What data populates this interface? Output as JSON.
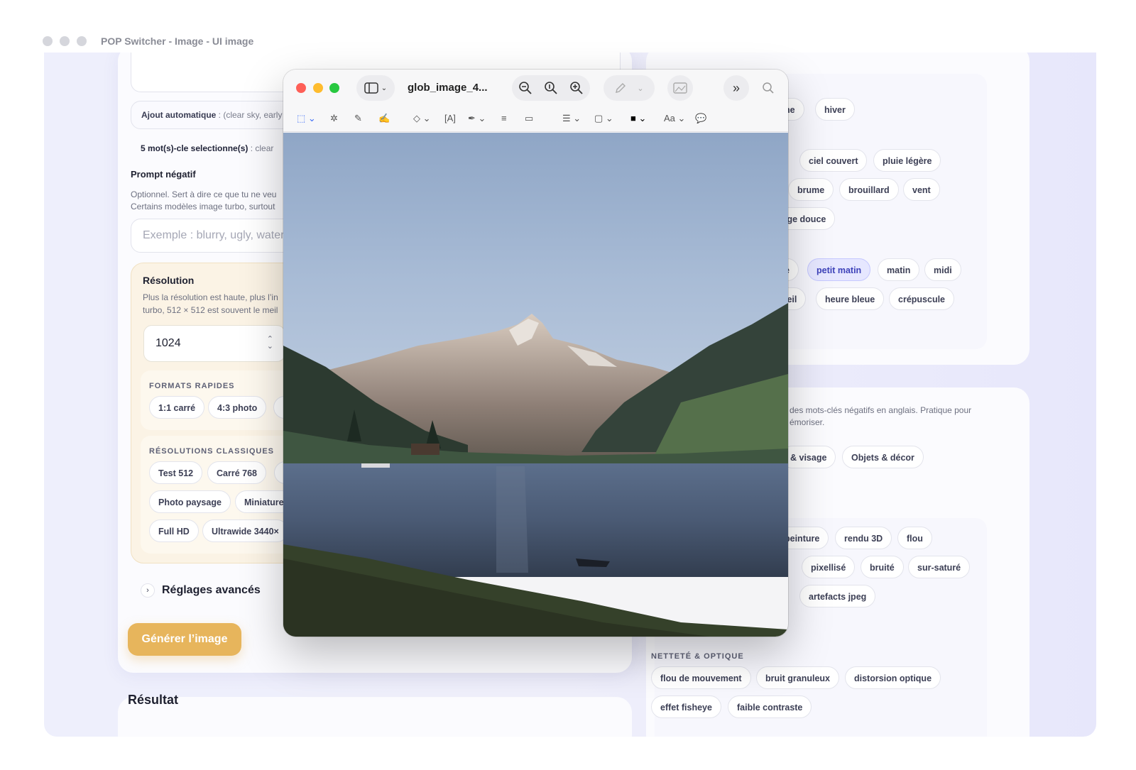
{
  "window": {
    "title": "POP Switcher - Image - UI image"
  },
  "left": {
    "auto_add_label": "Ajout automatique",
    "auto_add_text": " : (clear sky, early",
    "selected_label": "5 mot(s)-cle selectionne(s)",
    "selected_text": " : clear",
    "negative_title": "Prompt négatif",
    "negative_desc_1": "Optionnel. Sert à dire ce que tu ne veu",
    "negative_desc_2": "Certains modèles image turbo, surtout",
    "negative_placeholder": "Exemple : blurry, ugly, water",
    "resolution_title": "Résolution",
    "resolution_desc_1": "Plus la résolution est haute, plus l’in",
    "resolution_desc_2": "turbo, 512 × 512 est souvent le meil",
    "resolution_value": "1024",
    "quick_formats_label": "FORMATS RAPIDES",
    "quick_formats": [
      "1:1 carré",
      "4:3 photo"
    ],
    "classic_label": "RÉSOLUTIONS CLASSIQUES",
    "classic_row1": [
      "Test 512",
      "Carré 768"
    ],
    "classic_row2": [
      "Photo paysage",
      "Miniature"
    ],
    "classic_row3": [
      "Full HD",
      "Ultrawide 3440×"
    ],
    "advanced_label": "Réglages avancés",
    "generate_label": "Générer l’image",
    "result_title": "Résultat"
  },
  "right": {
    "season_tags": [
      "ne",
      "hiver"
    ],
    "weather_row1": [
      "ciel couvert",
      "pluie légère"
    ],
    "weather_row2": [
      "brume",
      "brouillard",
      "vent"
    ],
    "weather_row3": [
      "ige douce"
    ],
    "time_row1": [
      "e",
      "petit matin",
      "matin",
      "midi"
    ],
    "time_row2": [
      "leil",
      "heure bleue",
      "crépuscule"
    ],
    "neg_desc_1": "des mots-clés négatifs en anglais. Pratique pour",
    "neg_desc_2": "émoriser.",
    "neg_categories": [
      "& visage",
      "Objets & décor"
    ],
    "style_row1": [
      "peinture",
      "rendu 3D",
      "flou"
    ],
    "style_row2": [
      "pixellisé",
      "bruité",
      "sur-saturé"
    ],
    "style_row3": [
      "artefacts jpeg"
    ],
    "optics_label": "NETTETÉ & OPTIQUE",
    "optics_row1": [
      "flou de mouvement",
      "bruit granuleux",
      "distorsion optique"
    ],
    "optics_row2": [
      "effet fisheye",
      "faible contraste"
    ]
  },
  "preview": {
    "filename": "glob_image_4...",
    "colors": {
      "close": "#fe5f57",
      "minimize": "#febc2e",
      "zoom": "#28c840"
    }
  }
}
